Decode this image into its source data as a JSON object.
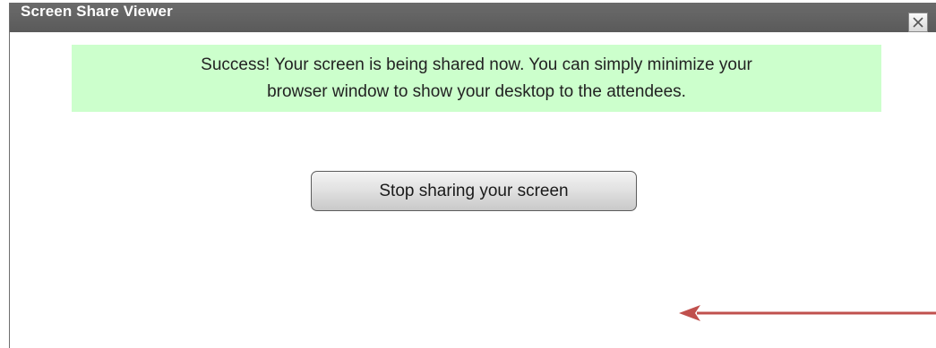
{
  "window": {
    "title": "Screen Share Viewer",
    "close_icon": "close-icon"
  },
  "message": {
    "line1": "Success! Your screen is being shared now. You can simply minimize your",
    "line2": "browser window to show your desktop to the attendees.",
    "background_color": "#ccffcc"
  },
  "actions": {
    "stop_label": "Stop sharing your screen"
  },
  "annotation": {
    "icon": "arrow-left-icon",
    "color": "#c0504d"
  },
  "colors": {
    "titlebar": "#606060",
    "title_text": "#ffffff"
  }
}
